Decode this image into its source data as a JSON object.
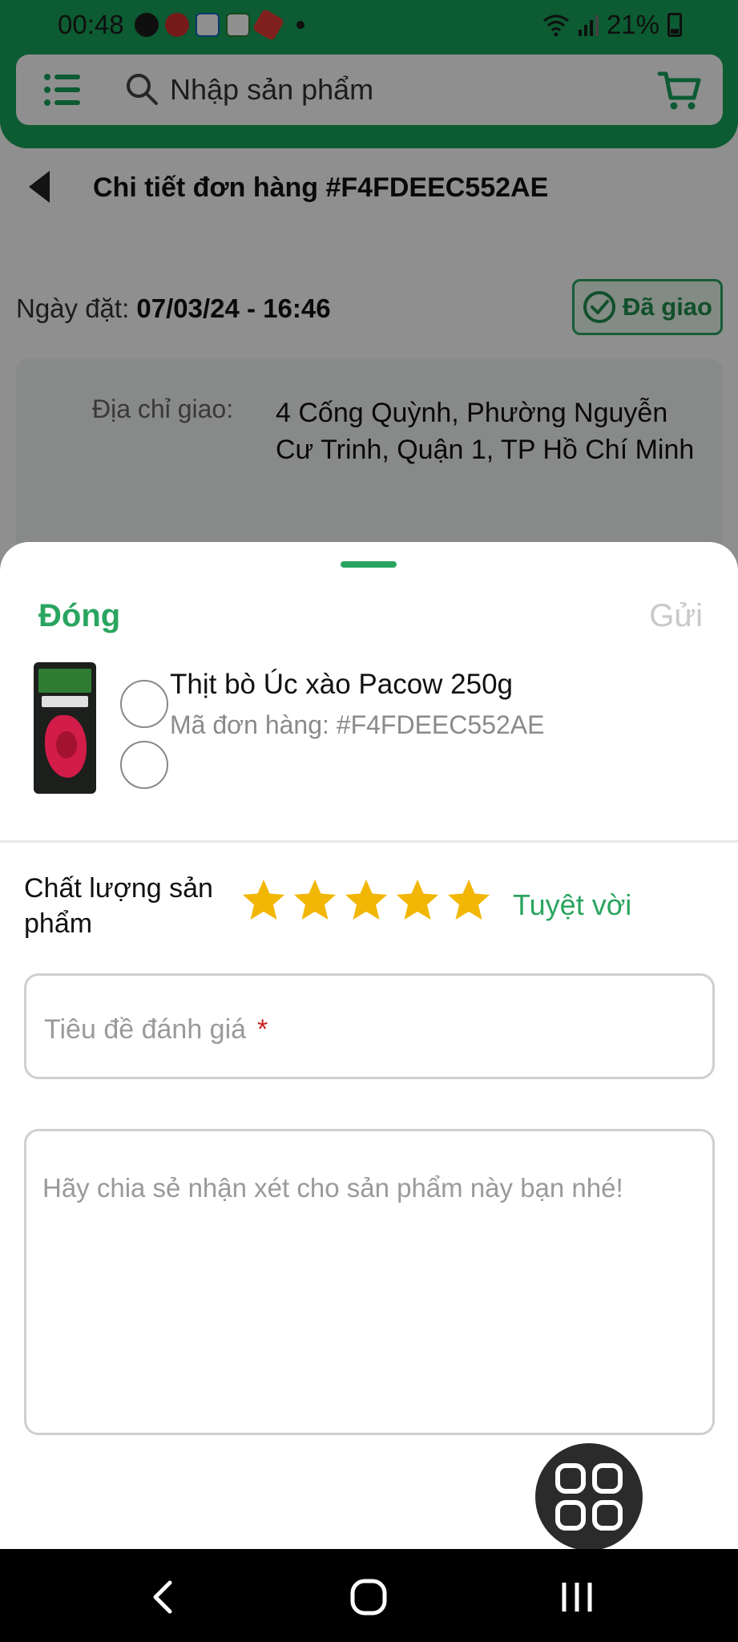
{
  "status_bar": {
    "time": "00:48",
    "battery": "21%"
  },
  "search": {
    "placeholder": "Nhập sản phẩm"
  },
  "order": {
    "title": "Chi tiết đơn hàng #F4FDEEC552AE",
    "date_label": "Ngày đặt:",
    "date_value": "07/03/24 - 16:46",
    "status": "Đã giao",
    "address_label": "Địa chỉ giao:",
    "address_value": "4 Cống Quỳnh, Phường Nguyễn Cư Trinh, Quận 1, TP Hồ Chí Minh"
  },
  "review_sheet": {
    "close_label": "Đóng",
    "send_label": "Gửi",
    "product_name": "Thịt bò Úc xào Pacow 250g",
    "order_code": "Mã đơn hàng: #F4FDEEC552AE",
    "quality_label": "Chất lượng sản phẩm",
    "rating": 5,
    "rating_max": 5,
    "rating_text": "Tuyệt vời",
    "title_placeholder": "Tiêu đề đánh giá",
    "required_mark": "*",
    "comment_placeholder": "Hãy chia sẻ nhận xét cho sản phẩm này bạn nhé!"
  },
  "colors": {
    "brand_green": "#17a25a",
    "accent_green": "#2aa560",
    "star": "#f2b705",
    "required": "#d01f1f"
  },
  "icons": [
    "menu-icon",
    "search-icon",
    "cart-icon",
    "back-icon",
    "check-circle-icon",
    "star-icon",
    "apps-grid-icon",
    "nav-back-icon",
    "nav-home-icon",
    "nav-recent-icon"
  ]
}
